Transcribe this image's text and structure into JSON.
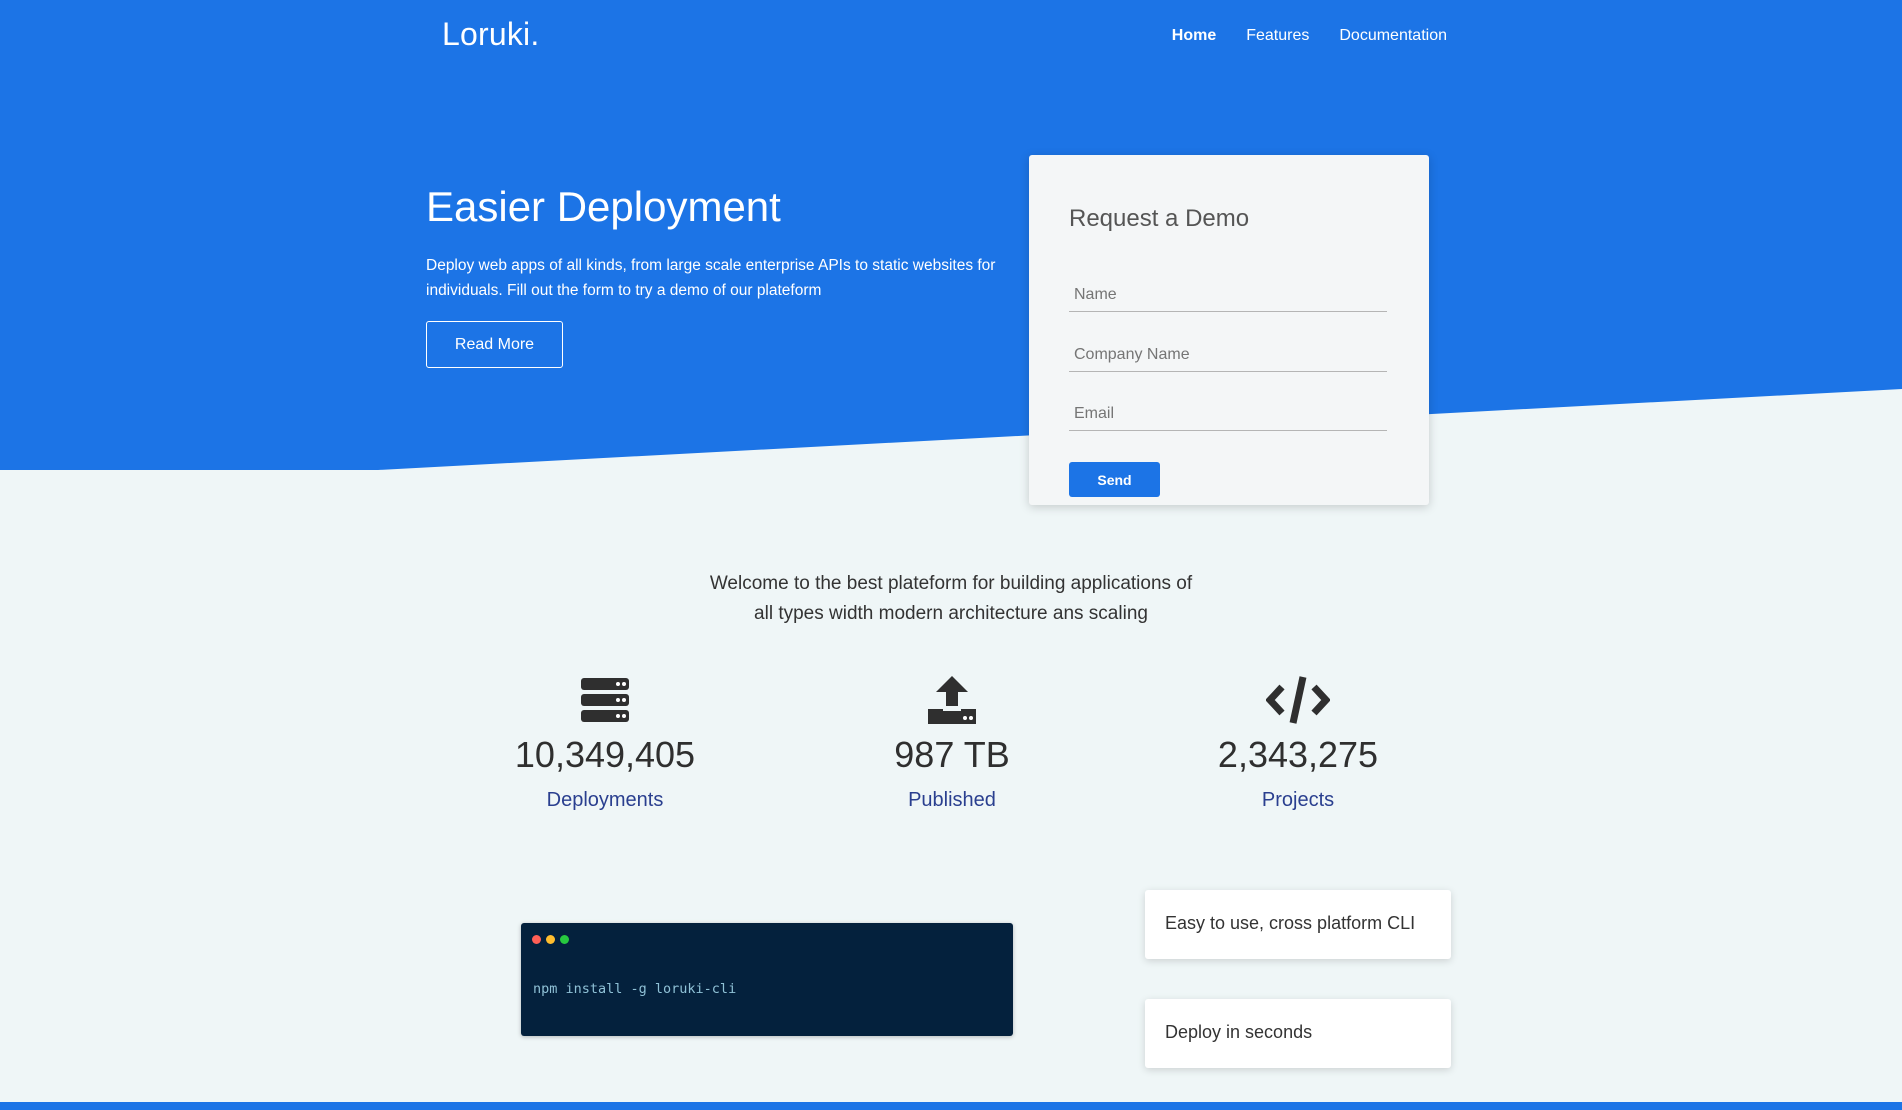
{
  "header": {
    "logo": "Loruki.",
    "nav": [
      {
        "label": "Home"
      },
      {
        "label": "Features"
      },
      {
        "label": "Documentation"
      }
    ]
  },
  "hero": {
    "title": "Easier Deployment",
    "text": "Deploy web apps of all kinds, from large scale enterprise APIs to static websites for individuals. Fill out the form to try a demo of our plateform",
    "button_label": "Read More"
  },
  "demo_form": {
    "title": "Request a Demo",
    "name_placeholder": "Name",
    "company_placeholder": "Company Name",
    "email_placeholder": "Email",
    "send_label": "Send"
  },
  "welcome_text": "Welcome to the best plateform for building applications of all types width modern architecture ans scaling",
  "stats": [
    {
      "icon": "server-icon",
      "value": "10,349,405",
      "label": "Deployments"
    },
    {
      "icon": "upload-icon",
      "value": "987 TB",
      "label": "Published"
    },
    {
      "icon": "code-icon",
      "value": "2,343,275",
      "label": "Projects"
    }
  ],
  "terminal": {
    "command": "npm install -g loruki-cli"
  },
  "features": [
    {
      "label": "Easy to use, cross platform CLI"
    },
    {
      "label": "Deploy in seconds"
    }
  ],
  "colors": {
    "primary": "#1c74e6",
    "background": "#eff6f7",
    "terminal_bg": "#04213d",
    "stat_label": "#2a3f8f"
  }
}
